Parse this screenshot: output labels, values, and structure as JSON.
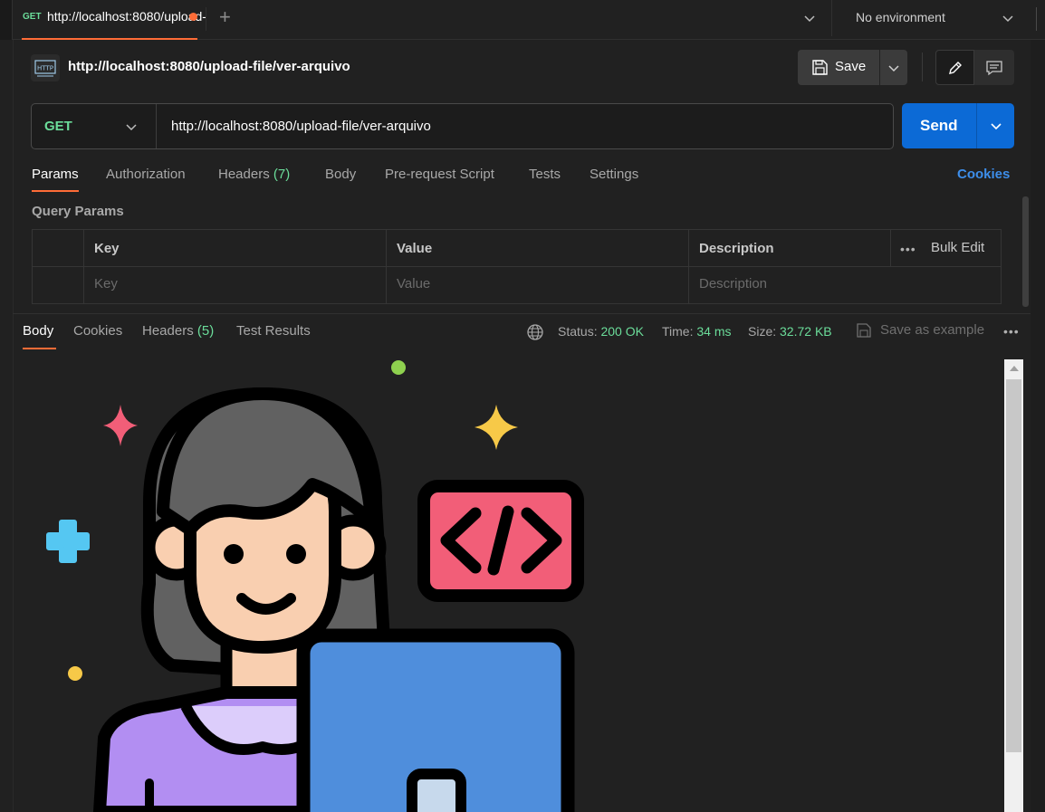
{
  "tabstrip": {
    "tab": {
      "method": "GET",
      "url": "http://localhost:8080/upload-file/ver-arquivo"
    },
    "environment": "No environment"
  },
  "request": {
    "title": "http://localhost:8080/upload-file/ver-arquivo",
    "save_label": "Save",
    "method": "GET",
    "url": "http://localhost:8080/upload-file/ver-arquivo",
    "send_label": "Send"
  },
  "request_tabs": {
    "params": "Params",
    "authorization": "Authorization",
    "headers": "Headers",
    "headers_count": "(7)",
    "body": "Body",
    "prerequest": "Pre-request Script",
    "tests": "Tests",
    "settings": "Settings",
    "cookies": "Cookies"
  },
  "query_params": {
    "label": "Query Params",
    "headers": {
      "key": "Key",
      "value": "Value",
      "description": "Description"
    },
    "bulk_edit": "Bulk Edit",
    "placeholders": {
      "key": "Key",
      "value": "Value",
      "description": "Description"
    }
  },
  "response_tabs": {
    "body": "Body",
    "cookies": "Cookies",
    "headers": "Headers",
    "headers_count": "(5)",
    "test_results": "Test Results"
  },
  "response_meta": {
    "status_label": "Status:",
    "status_value": "200 OK",
    "time_label": "Time:",
    "time_value": "34 ms",
    "size_label": "Size:",
    "size_value": "32.72 KB",
    "save_example": "Save as example"
  },
  "colors": {
    "accent": "#ff6c37",
    "send": "#0c6ad6",
    "method_get": "#6bdd9a",
    "link": "#3d8eea"
  }
}
